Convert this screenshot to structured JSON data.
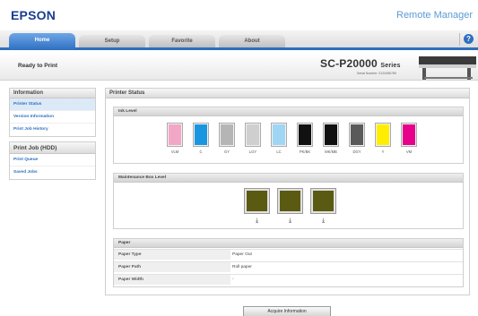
{
  "header": {
    "logo": "EPSON",
    "app_title": "Remote Manager"
  },
  "tabs": [
    {
      "label": "Home",
      "active": true
    },
    {
      "label": "Setup",
      "active": false
    },
    {
      "label": "Favorite",
      "active": false
    },
    {
      "label": "About",
      "active": false
    }
  ],
  "help_icon": "help-icon",
  "status": {
    "state": "Ready to Print",
    "model": "SC-P20000",
    "model_suffix": "Series",
    "serial": "Serial Number: 0123456789"
  },
  "sidebar": {
    "information": {
      "title": "Information",
      "items": [
        "Printer Status",
        "Version Information",
        "Print Job History"
      ]
    },
    "print_job": {
      "title": "Print Job (HDD)",
      "items": [
        "Print Queue",
        "Saved Jobs"
      ]
    }
  },
  "main": {
    "title": "Printer Status",
    "ink_level": {
      "title": "Ink Level",
      "inks": [
        {
          "label": "VLM",
          "color": "#f2a7c6",
          "level": 1.0
        },
        {
          "label": "C",
          "color": "#1a96e0",
          "level": 1.0
        },
        {
          "label": "GY",
          "color": "#b5b5b5",
          "level": 1.0
        },
        {
          "label": "LGY",
          "color": "#cfcfcf",
          "level": 1.0
        },
        {
          "label": "LC",
          "color": "#9fd6f3",
          "level": 1.0
        },
        {
          "label": "PK/BK",
          "color": "#111111",
          "level": 1.0
        },
        {
          "label": "MK/MB",
          "color": "#111111",
          "level": 1.0
        },
        {
          "label": "DGY",
          "color": "#5a5a5a",
          "level": 1.0
        },
        {
          "label": "Y",
          "color": "#ffee00",
          "level": 1.0
        },
        {
          "label": "VM",
          "color": "#e6008a",
          "level": 1.0
        }
      ]
    },
    "maintenance": {
      "title": "Maintenance Box Level",
      "boxes": [
        {
          "color": "#5b5a12",
          "level": 1.0
        },
        {
          "color": "#5b5a12",
          "level": 1.0
        },
        {
          "color": "#5b5a12",
          "level": 1.0
        }
      ],
      "icon": "download-arrow-icon"
    },
    "paper": {
      "title": "Paper",
      "rows": [
        {
          "label": "Paper Type",
          "value": "Paper Out"
        },
        {
          "label": "Paper Path",
          "value": "Roll paper"
        },
        {
          "label": "Paper Width",
          "value": "-"
        }
      ]
    }
  },
  "acquire_button": "Acquire Information",
  "colors": {
    "accent": "#2e6fc0",
    "logo": "#1a3d8f",
    "title": "#5a9bd5"
  }
}
